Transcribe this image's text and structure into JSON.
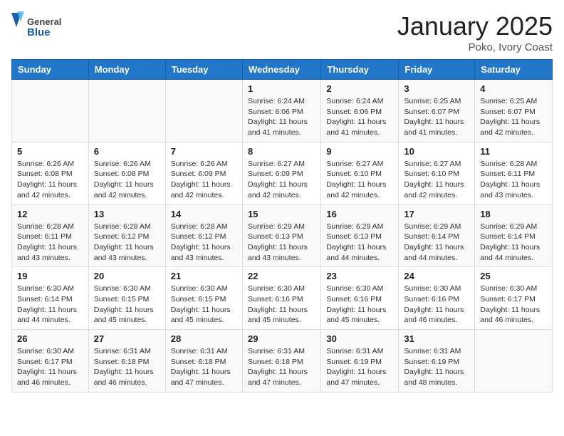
{
  "header": {
    "logo_general": "General",
    "logo_blue": "Blue",
    "month_year": "January 2025",
    "location": "Poko, Ivory Coast"
  },
  "weekdays": [
    "Sunday",
    "Monday",
    "Tuesday",
    "Wednesday",
    "Thursday",
    "Friday",
    "Saturday"
  ],
  "weeks": [
    [
      {
        "day": "",
        "info": ""
      },
      {
        "day": "",
        "info": ""
      },
      {
        "day": "",
        "info": ""
      },
      {
        "day": "1",
        "info": "Sunrise: 6:24 AM\nSunset: 6:06 PM\nDaylight: 11 hours and 41 minutes."
      },
      {
        "day": "2",
        "info": "Sunrise: 6:24 AM\nSunset: 6:06 PM\nDaylight: 11 hours and 41 minutes."
      },
      {
        "day": "3",
        "info": "Sunrise: 6:25 AM\nSunset: 6:07 PM\nDaylight: 11 hours and 41 minutes."
      },
      {
        "day": "4",
        "info": "Sunrise: 6:25 AM\nSunset: 6:07 PM\nDaylight: 11 hours and 42 minutes."
      }
    ],
    [
      {
        "day": "5",
        "info": "Sunrise: 6:26 AM\nSunset: 6:08 PM\nDaylight: 11 hours and 42 minutes."
      },
      {
        "day": "6",
        "info": "Sunrise: 6:26 AM\nSunset: 6:08 PM\nDaylight: 11 hours and 42 minutes."
      },
      {
        "day": "7",
        "info": "Sunrise: 6:26 AM\nSunset: 6:09 PM\nDaylight: 11 hours and 42 minutes."
      },
      {
        "day": "8",
        "info": "Sunrise: 6:27 AM\nSunset: 6:09 PM\nDaylight: 11 hours and 42 minutes."
      },
      {
        "day": "9",
        "info": "Sunrise: 6:27 AM\nSunset: 6:10 PM\nDaylight: 11 hours and 42 minutes."
      },
      {
        "day": "10",
        "info": "Sunrise: 6:27 AM\nSunset: 6:10 PM\nDaylight: 11 hours and 42 minutes."
      },
      {
        "day": "11",
        "info": "Sunrise: 6:28 AM\nSunset: 6:11 PM\nDaylight: 11 hours and 43 minutes."
      }
    ],
    [
      {
        "day": "12",
        "info": "Sunrise: 6:28 AM\nSunset: 6:11 PM\nDaylight: 11 hours and 43 minutes."
      },
      {
        "day": "13",
        "info": "Sunrise: 6:28 AM\nSunset: 6:12 PM\nDaylight: 11 hours and 43 minutes."
      },
      {
        "day": "14",
        "info": "Sunrise: 6:28 AM\nSunset: 6:12 PM\nDaylight: 11 hours and 43 minutes."
      },
      {
        "day": "15",
        "info": "Sunrise: 6:29 AM\nSunset: 6:13 PM\nDaylight: 11 hours and 43 minutes."
      },
      {
        "day": "16",
        "info": "Sunrise: 6:29 AM\nSunset: 6:13 PM\nDaylight: 11 hours and 44 minutes."
      },
      {
        "day": "17",
        "info": "Sunrise: 6:29 AM\nSunset: 6:14 PM\nDaylight: 11 hours and 44 minutes."
      },
      {
        "day": "18",
        "info": "Sunrise: 6:29 AM\nSunset: 6:14 PM\nDaylight: 11 hours and 44 minutes."
      }
    ],
    [
      {
        "day": "19",
        "info": "Sunrise: 6:30 AM\nSunset: 6:14 PM\nDaylight: 11 hours and 44 minutes."
      },
      {
        "day": "20",
        "info": "Sunrise: 6:30 AM\nSunset: 6:15 PM\nDaylight: 11 hours and 45 minutes."
      },
      {
        "day": "21",
        "info": "Sunrise: 6:30 AM\nSunset: 6:15 PM\nDaylight: 11 hours and 45 minutes."
      },
      {
        "day": "22",
        "info": "Sunrise: 6:30 AM\nSunset: 6:16 PM\nDaylight: 11 hours and 45 minutes."
      },
      {
        "day": "23",
        "info": "Sunrise: 6:30 AM\nSunset: 6:16 PM\nDaylight: 11 hours and 45 minutes."
      },
      {
        "day": "24",
        "info": "Sunrise: 6:30 AM\nSunset: 6:16 PM\nDaylight: 11 hours and 46 minutes."
      },
      {
        "day": "25",
        "info": "Sunrise: 6:30 AM\nSunset: 6:17 PM\nDaylight: 11 hours and 46 minutes."
      }
    ],
    [
      {
        "day": "26",
        "info": "Sunrise: 6:30 AM\nSunset: 6:17 PM\nDaylight: 11 hours and 46 minutes."
      },
      {
        "day": "27",
        "info": "Sunrise: 6:31 AM\nSunset: 6:18 PM\nDaylight: 11 hours and 46 minutes."
      },
      {
        "day": "28",
        "info": "Sunrise: 6:31 AM\nSunset: 6:18 PM\nDaylight: 11 hours and 47 minutes."
      },
      {
        "day": "29",
        "info": "Sunrise: 6:31 AM\nSunset: 6:18 PM\nDaylight: 11 hours and 47 minutes."
      },
      {
        "day": "30",
        "info": "Sunrise: 6:31 AM\nSunset: 6:19 PM\nDaylight: 11 hours and 47 minutes."
      },
      {
        "day": "31",
        "info": "Sunrise: 6:31 AM\nSunset: 6:19 PM\nDaylight: 11 hours and 48 minutes."
      },
      {
        "day": "",
        "info": ""
      }
    ]
  ]
}
